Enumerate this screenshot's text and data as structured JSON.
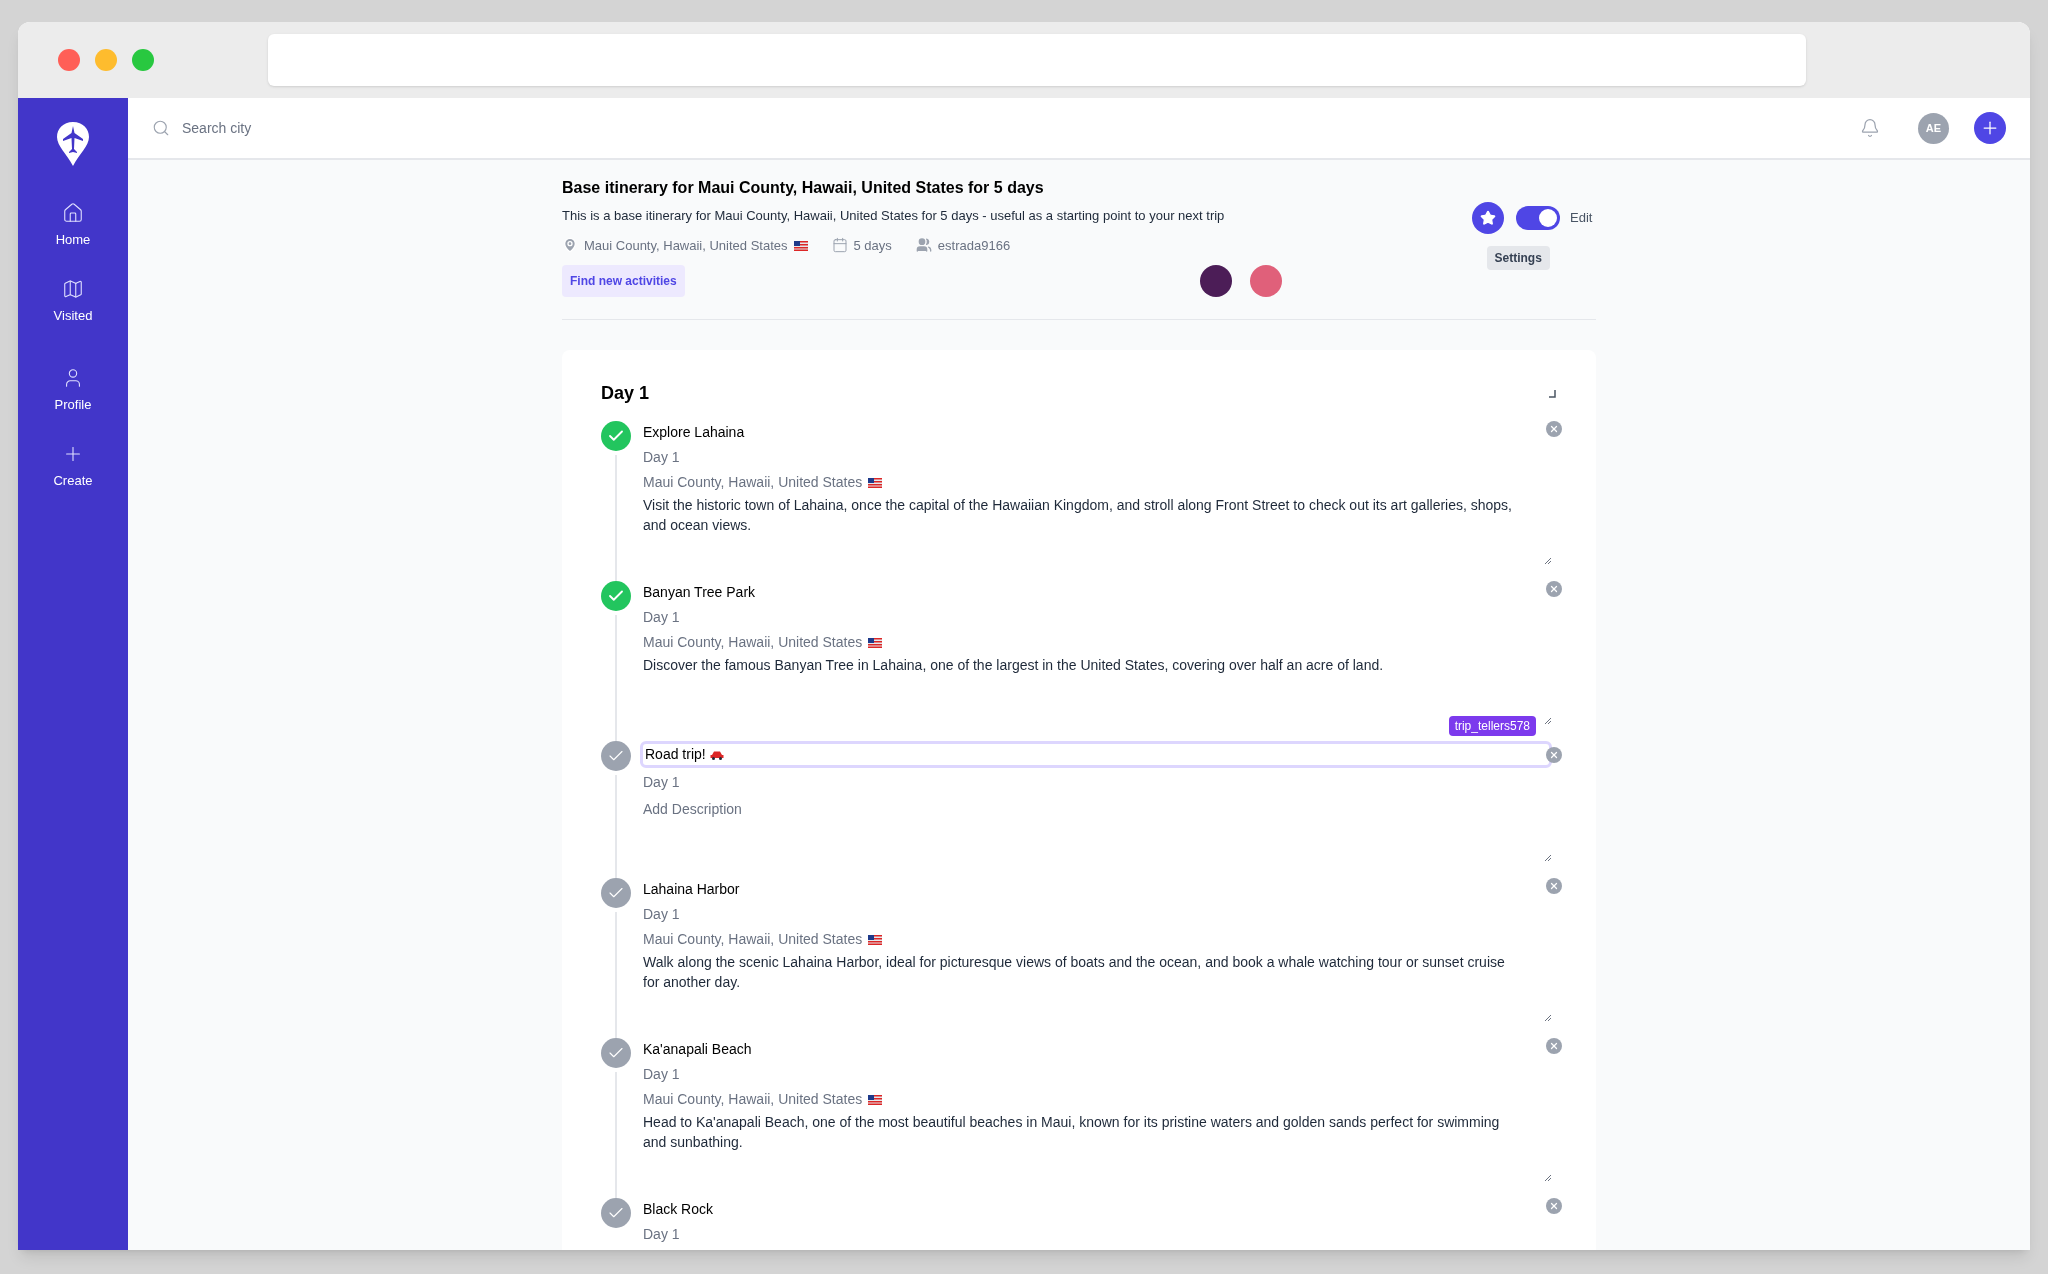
{
  "sidebar": {
    "items": [
      {
        "label": "Home"
      },
      {
        "label": "Visited"
      },
      {
        "label": "Profile"
      },
      {
        "label": "Create"
      }
    ]
  },
  "topbar": {
    "search": {
      "placeholder": "Search city"
    },
    "avatar_initials": "AE"
  },
  "trip": {
    "title": "Base itinerary for Maui County, Hawaii, United States for 5 days",
    "description": "This is a base itinerary for Maui County, Hawaii, United States for 5 days - useful as a starting point to your next trip",
    "location": "Maui County, Hawaii, United States",
    "duration": "5 days",
    "owner": "estrada9166",
    "find_button": "Find new activities",
    "favorite": true,
    "edit_mode": {
      "label": "Edit",
      "on": true
    },
    "settings_button": "Settings"
  },
  "day": {
    "title": "Day 1",
    "activities": [
      {
        "title": "Explore Lahaina",
        "day": "Day 1",
        "location": "Maui County, Hawaii, United States",
        "description": "Visit the historic town of Lahaina, once the capital of the Hawaiian Kingdom, and stroll along Front Street to check out its art galleries, shops, and ocean views.",
        "kind": "completed",
        "editing": false
      },
      {
        "title": "Banyan Tree Park",
        "day": "Day 1",
        "location": "Maui County, Hawaii, United States",
        "description": "Discover the famous Banyan Tree in Lahaina, one of the largest in the United States, covering over half an acre of land.",
        "kind": "completed",
        "editing": false
      },
      {
        "title": "Road trip!",
        "day": "Day 1",
        "placeholder": "Add Description",
        "kind": "pending",
        "editing": true,
        "editor_tag": "trip_tellers578"
      },
      {
        "title": "Lahaina Harbor",
        "day": "Day 1",
        "location": "Maui County, Hawaii, United States",
        "description": "Walk along the scenic Lahaina Harbor, ideal for picturesque views of boats and the ocean, and book a whale watching tour or sunset cruise for another day.",
        "kind": "pending",
        "editing": false
      },
      {
        "title": "Ka'anapali Beach",
        "day": "Day 1",
        "location": "Maui County, Hawaii, United States",
        "description": "Head to Ka'anapali Beach, one of the most beautiful beaches in Maui, known for its pristine waters and golden sands perfect for swimming and sunbathing.",
        "kind": "pending",
        "editing": false
      },
      {
        "title": "Black Rock",
        "day": "Day 1",
        "kind": "pending",
        "editing": false
      }
    ]
  }
}
